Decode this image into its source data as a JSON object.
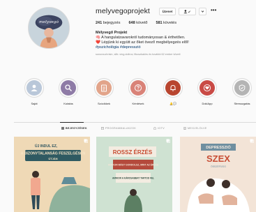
{
  "profile": {
    "avatar_text": "melyvegó",
    "username": "melyvegoprojekt",
    "message_label": "Üzenet",
    "stats": {
      "posts_count": "241",
      "posts_label": "bejegyzés",
      "followers_count": "648",
      "followers_label": "követő",
      "following_count": "581",
      "following_label": "követés"
    },
    "bio": {
      "name": "Mélyvegő Projekt",
      "line1": "🧠 A hangulatzavarokról tudományosan & érthetően.",
      "line2": "❤️ Lépjünk ki együtt az őket övező megbélyegzés elől!",
      "tags": "#pszichológia #depresszió",
      "followed_by": "sonorzuchrisin, sllb:.ving.dollrov, fikuszkakirs és további 62 ember követi"
    }
  },
  "highlights": [
    {
      "label": "Saját",
      "icon": "user-icon",
      "color": "#b9c7d9"
    },
    {
      "label": "Kutatás",
      "icon": "search-icon",
      "color": "#8e7ba6"
    },
    {
      "label": "Szócikkek",
      "icon": "clipboard-icon",
      "color": "#e2a48a"
    },
    {
      "label": "Kérdések",
      "icon": "question-icon",
      "color": "#d98278"
    },
    {
      "label": "🔔💬",
      "icon": "bell-icon",
      "color": "#b8452f"
    },
    {
      "label": "DokiApp",
      "icon": "heart-icon",
      "color": "#c94a45"
    },
    {
      "label": "Stresszgatás",
      "icon": "shield-icon",
      "color": "#b4b4b4"
    }
  ],
  "tabs": [
    {
      "label": "BEJEGYZÉSEK",
      "icon": "grid-icon",
      "active": true
    },
    {
      "label": "PROGRAMMALAKZOK",
      "icon": "calendar-icon",
      "active": false
    },
    {
      "label": "IGTV",
      "icon": "tv-icon",
      "active": false
    },
    {
      "label": "MEGJELÖLVE",
      "icon": "tag-icon",
      "active": false
    }
  ],
  "posts": [
    {
      "bg": "#efd9b6",
      "top_text": "ÚJ INDUL EZ,",
      "banner": "A BIZONYTALANSÁG FESZELGÉSEN",
      "small": "ÚTJÁN"
    },
    {
      "bg": "#cfe2d2",
      "title": "ROSSZ ÉRZÉS",
      "text1": "AMIKOR MÁST GONDOLSZ, MINT AZ ÉRZÉS",
      "text2": "AMIKOR A KÁROSABBAT TARTOD FEL"
    },
    {
      "bg": "#f3e4d7",
      "title1": "DEPRESSZIÓ",
      "title2": "SZEX",
      "small": "ÖSSZEFÜGG"
    }
  ]
}
